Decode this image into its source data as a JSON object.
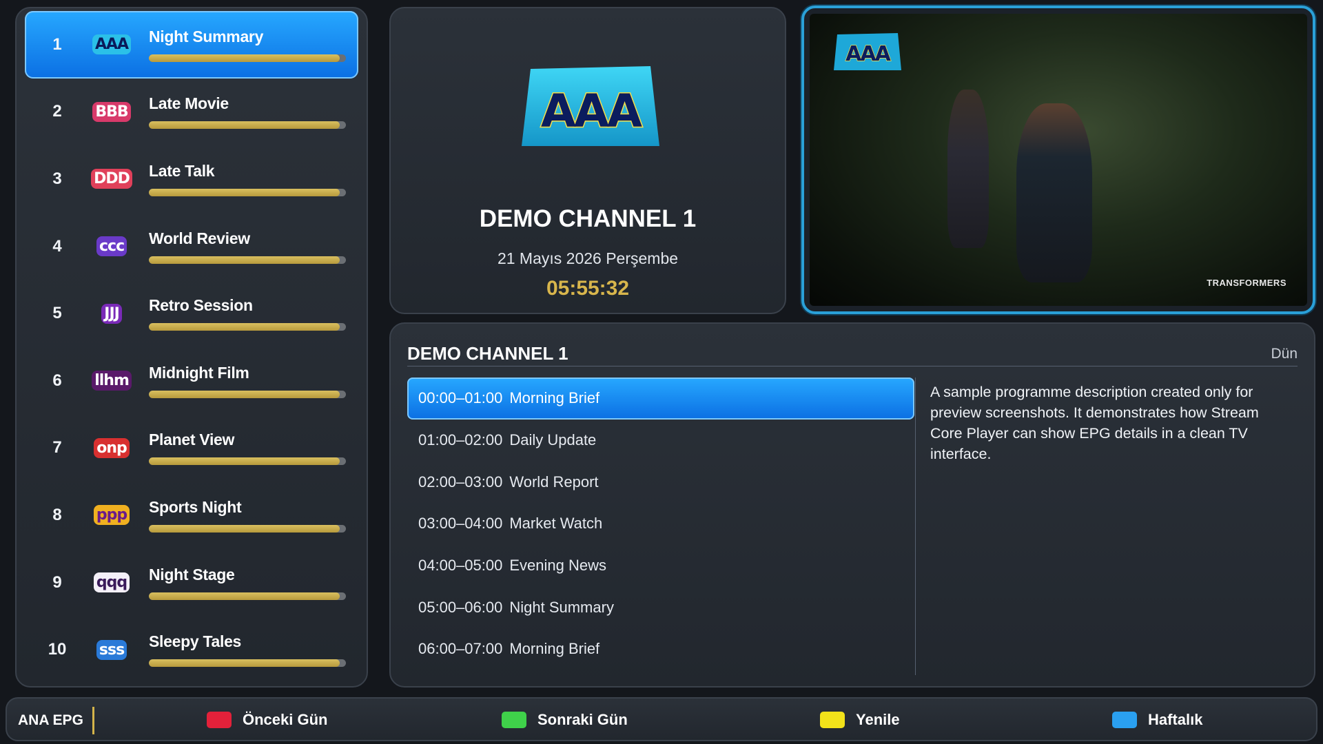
{
  "channels": [
    {
      "number": "1",
      "logo_text": "AAA",
      "name": "Night Summary",
      "progress": 0.97,
      "logo_fg": "#0a1a5a",
      "logo_bg": "#2bc0e8",
      "active": true
    },
    {
      "number": "2",
      "logo_text": "BBB",
      "name": "Late Movie",
      "progress": 0.97,
      "logo_fg": "#ffffff",
      "logo_bg": "#d83a6a"
    },
    {
      "number": "3",
      "logo_text": "DDD",
      "name": "Late Talk",
      "progress": 0.97,
      "logo_fg": "#ffffff",
      "logo_bg": "#e0405a"
    },
    {
      "number": "4",
      "logo_text": "ccc",
      "name": "World Review",
      "progress": 0.97,
      "logo_fg": "#ffffff",
      "logo_bg": "#6a3ac8"
    },
    {
      "number": "5",
      "logo_text": "JJJ",
      "name": "Retro Session",
      "progress": 0.97,
      "logo_fg": "#ffffff",
      "logo_bg": "#7a2ab8"
    },
    {
      "number": "6",
      "logo_text": "llhm",
      "name": "Midnight Film",
      "progress": 0.97,
      "logo_fg": "#ffffff",
      "logo_bg": "#5a1a6a"
    },
    {
      "number": "7",
      "logo_text": "onp",
      "name": "Planet View",
      "progress": 0.97,
      "logo_fg": "#ffffff",
      "logo_bg": "#d83030"
    },
    {
      "number": "8",
      "logo_text": "ppp",
      "name": "Sports Night",
      "progress": 0.97,
      "logo_fg": "#6a1a8a",
      "logo_bg": "#f0b020"
    },
    {
      "number": "9",
      "logo_text": "qqq",
      "name": "Night Stage",
      "progress": 0.97,
      "logo_fg": "#3a1a5a",
      "logo_bg": "#f4f0f8"
    },
    {
      "number": "10",
      "logo_text": "sss",
      "name": "Sleepy Tales",
      "progress": 0.97,
      "logo_fg": "#ffffff",
      "logo_bg": "#2a7ad8"
    }
  ],
  "info": {
    "logo_text": "AAA",
    "channel_title": "DEMO CHANNEL 1",
    "date": "21 Mayıs 2026 Perşembe",
    "clock": "05:55:32"
  },
  "video": {
    "watermark_logo_text": "AAA",
    "caption": "TRANSFORMERS"
  },
  "epg": {
    "channel_title": "DEMO CHANNEL 1",
    "day_label": "Dün",
    "programs": [
      {
        "time": "00:00–01:00",
        "title": "Morning Brief",
        "active": true
      },
      {
        "time": "01:00–02:00",
        "title": "Daily Update"
      },
      {
        "time": "02:00–03:00",
        "title": "World Report"
      },
      {
        "time": "03:00–04:00",
        "title": "Market Watch"
      },
      {
        "time": "04:00–05:00",
        "title": "Evening News"
      },
      {
        "time": "05:00–06:00",
        "title": "Night Summary"
      },
      {
        "time": "06:00–07:00",
        "title": "Morning Brief"
      }
    ],
    "description": "A sample programme description created only for preview screenshots. It demonstrates how Stream Core Player can show EPG details in a clean TV interface."
  },
  "bottom_bar": {
    "title": "ANA EPG",
    "keys": [
      {
        "label": "Önceki Gün",
        "color": "#e3213a"
      },
      {
        "label": "Sonraki Gün",
        "color": "#3fd14a"
      },
      {
        "label": "Yenile",
        "color": "#f2e21a"
      },
      {
        "label": "Haftalık",
        "color": "#2aa0f0"
      }
    ]
  },
  "colors": {
    "accent_blue": "#0b6fe3",
    "progress_gold": "#c9ab4a",
    "clock_gold": "#d8b64c",
    "video_border": "#2aa0d8"
  }
}
